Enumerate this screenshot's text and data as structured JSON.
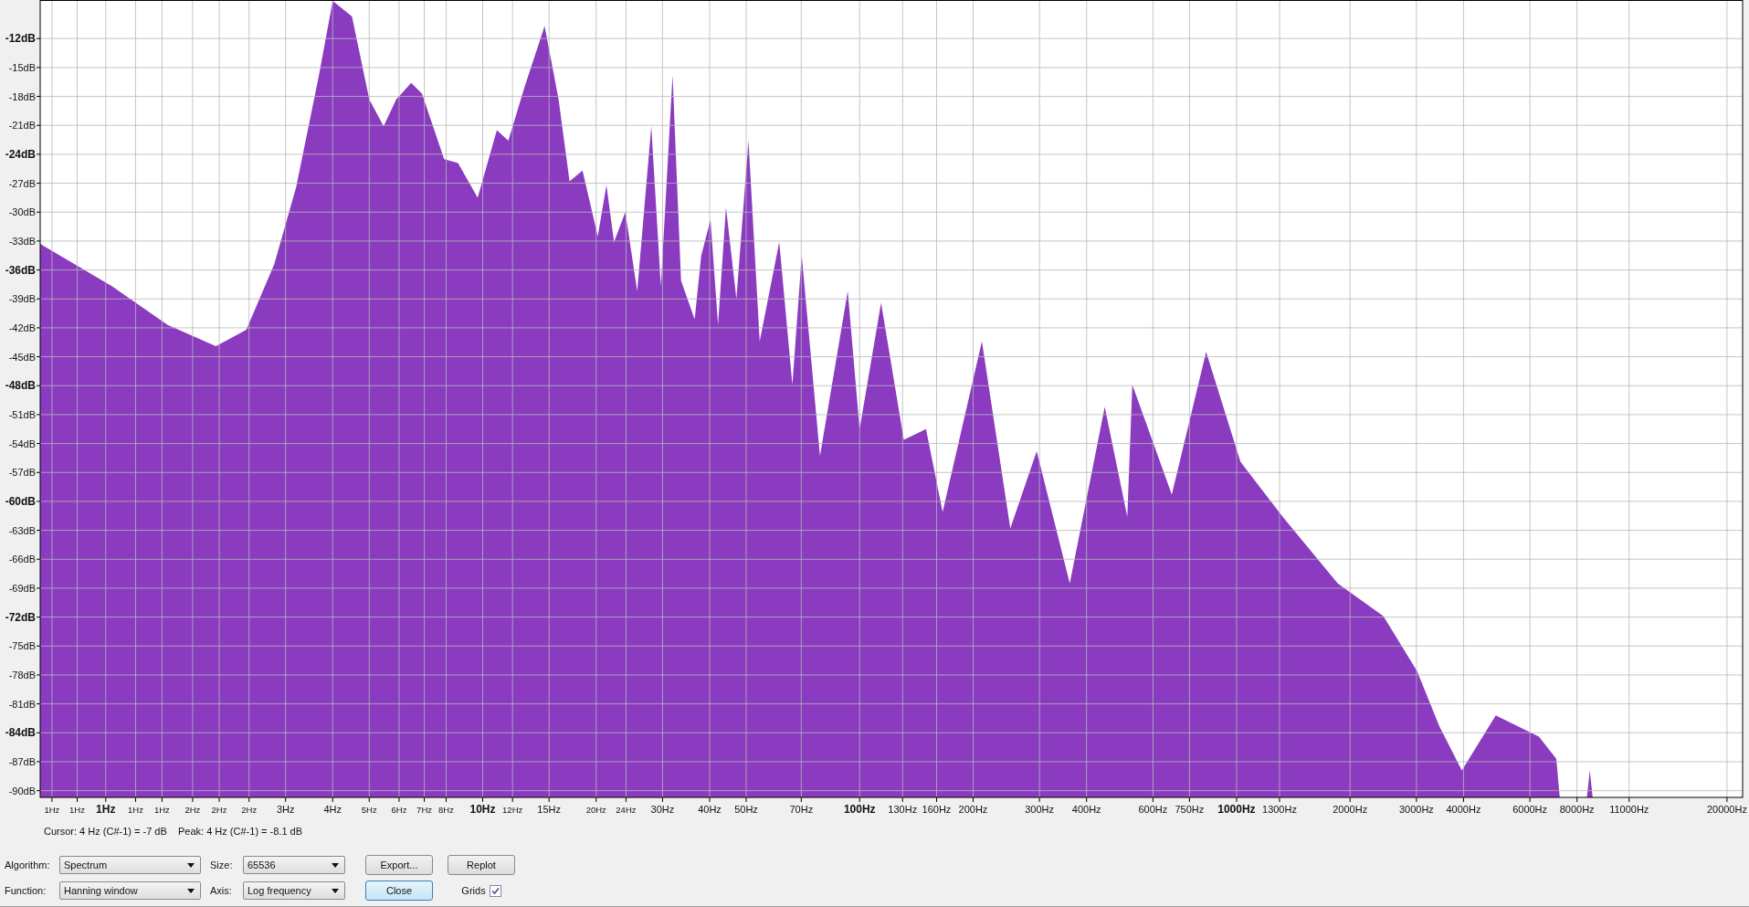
{
  "spectrum": {
    "color": "#8a3bc0",
    "y_labels": [
      "-12dB",
      "-15dB",
      "-18dB",
      "-21dB",
      "-24dB",
      "-27dB",
      "-30dB",
      "-33dB",
      "-36dB",
      "-39dB",
      "-42dB",
      "-45dB",
      "-48dB",
      "-51dB",
      "-54dB",
      "-57dB",
      "-60dB",
      "-63dB",
      "-66dB",
      "-69dB",
      "-72dB",
      "-75dB",
      "-78dB",
      "-81dB",
      "-84dB",
      "-87dB",
      "-90dB"
    ],
    "x_labels": [
      "1Hz",
      "1Hz",
      "1Hz",
      "1Hz",
      "1Hz",
      "2Hz",
      "2Hz",
      "2Hz",
      "3Hz",
      "4Hz",
      "5Hz",
      "6Hz",
      "7Hz",
      "8Hz",
      "10Hz",
      "12Hz",
      "15Hz",
      "20Hz",
      "24Hz",
      "30Hz",
      "40Hz",
      "50Hz",
      "70Hz",
      "100Hz",
      "130Hz",
      "160Hz",
      "200Hz",
      "300Hz",
      "400Hz",
      "600Hz",
      "750Hz",
      "1000Hz",
      "1300Hz",
      "2000Hz",
      "3000Hz",
      "4000Hz",
      "6000Hz",
      "8000Hz",
      "11000Hz",
      "20000Hz"
    ]
  },
  "status": "Cursor: 4 Hz (C#-1) = -7 dB    Peak: 4 Hz (C#-1) = -8.1 dB",
  "controls": {
    "algorithm": {
      "label": "Algorithm:",
      "value": "Spectrum"
    },
    "size": {
      "label": "Size:",
      "value": "65536"
    },
    "function": {
      "label": "Function:",
      "value": "Hanning window"
    },
    "axis": {
      "label": "Axis:",
      "value": "Log frequency"
    },
    "buttons": [
      {
        "label": "Export...",
        "focused": false
      },
      {
        "label": "Replot",
        "focused": false
      },
      {
        "label": "Close",
        "focused": true
      }
    ],
    "grids": {
      "label": "Grids",
      "checked": true
    }
  }
}
